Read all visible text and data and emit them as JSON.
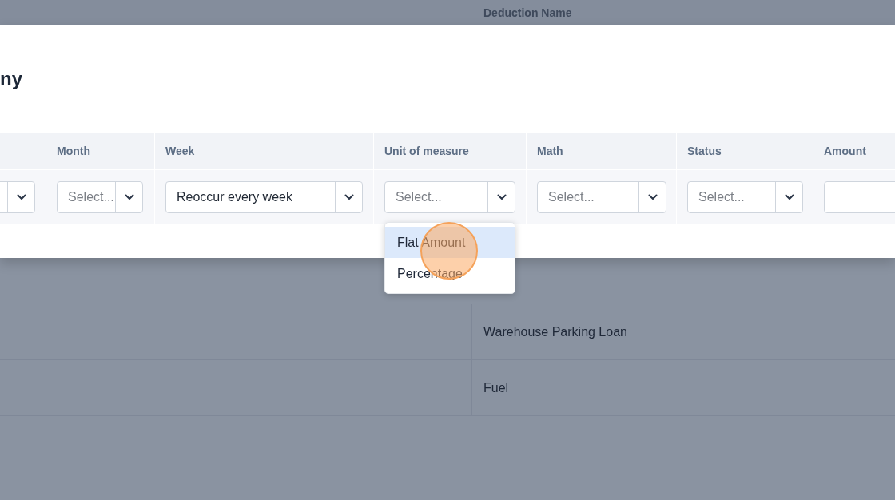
{
  "background": {
    "column_header": "Deduction Name",
    "rows": [
      {
        "deduction_name": "Warehouse Parking Loan"
      },
      {
        "deduction_name": "Fuel"
      }
    ]
  },
  "modal": {
    "title": "ny",
    "columns": [
      {
        "kind": "select"
      },
      {
        "header": "Month",
        "kind": "select",
        "placeholder": "Select..."
      },
      {
        "header": "Week",
        "kind": "select",
        "value": "Reoccur every week"
      },
      {
        "header": "Unit of measure",
        "kind": "select",
        "placeholder": "Select...",
        "dropdown": {
          "options": [
            {
              "label": "Flat Amount",
              "selected": true
            },
            {
              "label": "Percentage",
              "selected": false
            }
          ]
        }
      },
      {
        "header": "Math",
        "kind": "select",
        "placeholder": "Select..."
      },
      {
        "header": "Status",
        "kind": "select",
        "placeholder": "Select..."
      },
      {
        "header": "Amount",
        "kind": "input"
      }
    ]
  }
}
